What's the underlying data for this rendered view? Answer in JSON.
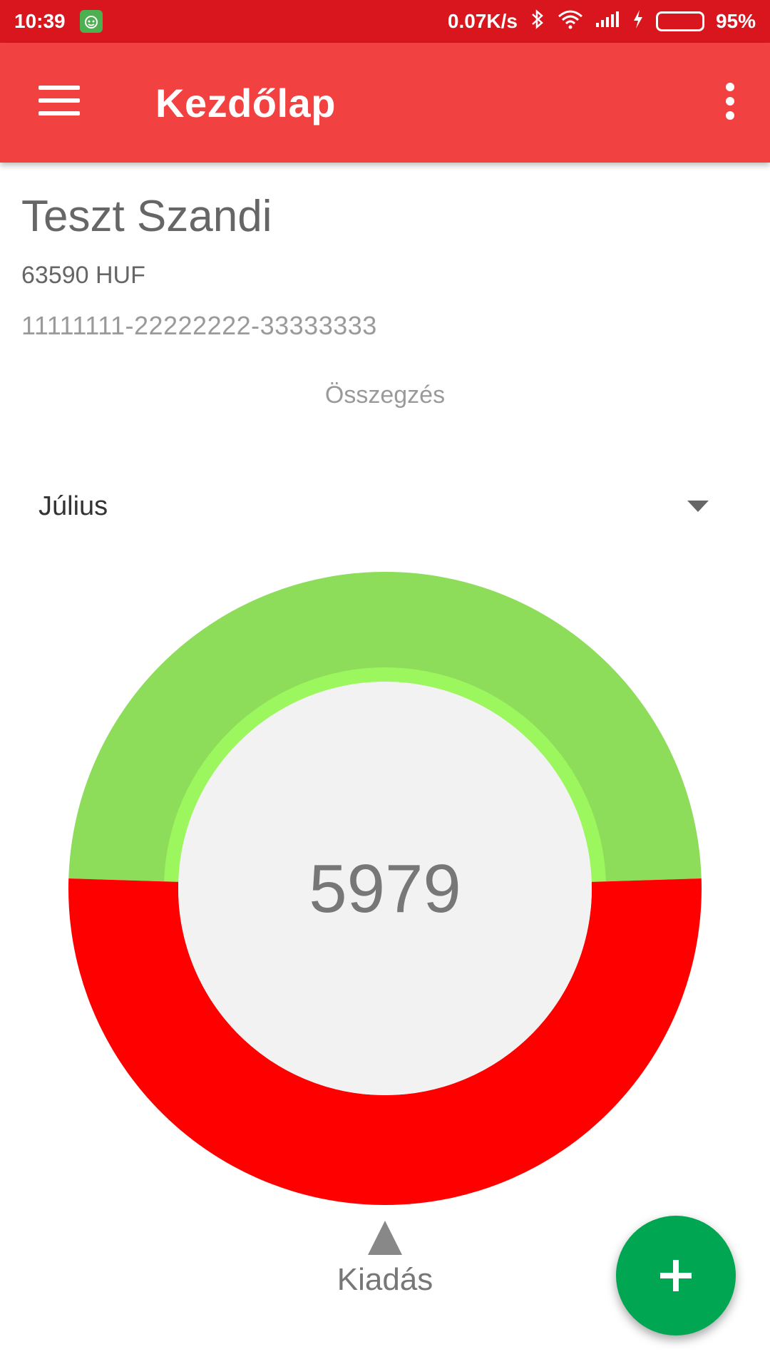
{
  "status_bar": {
    "time": "10:39",
    "network_speed": "0.07K/s",
    "battery_percent": "95%",
    "battery_level": 0.95,
    "icons": [
      "notification-app-icon",
      "bluetooth-icon",
      "wifi-icon",
      "signal-icon",
      "charging-icon",
      "battery-icon"
    ]
  },
  "app_bar": {
    "title": "Kezdőlap",
    "menu_icon": "hamburger-menu-icon",
    "more_icon": "more-vert-icon"
  },
  "account": {
    "name": "Teszt Szandi",
    "balance": "63590 HUF",
    "number": "11111111-22222222-33333333"
  },
  "summary": {
    "label": "Összegzés",
    "month_selected": "Július"
  },
  "colors": {
    "status_bar": "#d9161d",
    "app_bar": "#f24141",
    "income": "#8ddc5a",
    "income_inner": "#9cf75f",
    "expense": "#ff0000",
    "fab": "#00a651"
  },
  "chart_data": {
    "type": "pie",
    "center_value": "5979",
    "pointer_label": "Kiadás",
    "slices": [
      {
        "value": 0.49,
        "color": "#8ddc5a"
      },
      {
        "value": 0.51,
        "color": "#ff0000"
      }
    ]
  },
  "fab": {
    "icon": "plus-icon"
  }
}
